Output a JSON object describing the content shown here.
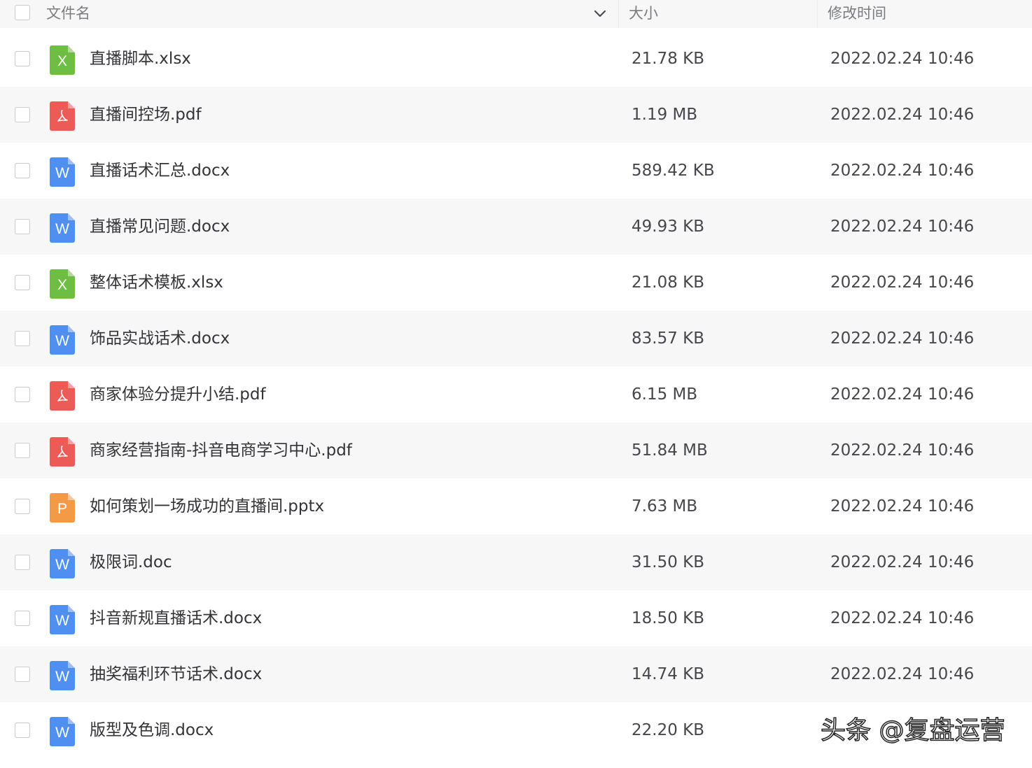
{
  "header": {
    "name_label": "文件名",
    "size_label": "大小",
    "modified_label": "修改时间"
  },
  "file_type_colors": {
    "xlsx": "#6fbe44",
    "pdf": "#ec5b56",
    "docx": "#4e8ff0",
    "doc": "#4e8ff0",
    "pptx": "#f39a47"
  },
  "files": [
    {
      "name": "直播脚本.xlsx",
      "type": "xlsx",
      "icon_letter": "X",
      "size": "21.78 KB",
      "modified": "2022.02.24 10:46"
    },
    {
      "name": "直播间控场.pdf",
      "type": "pdf",
      "icon_letter": "",
      "size": "1.19 MB",
      "modified": "2022.02.24 10:46"
    },
    {
      "name": "直播话术汇总.docx",
      "type": "docx",
      "icon_letter": "W",
      "size": "589.42 KB",
      "modified": "2022.02.24 10:46"
    },
    {
      "name": "直播常见问题.docx",
      "type": "docx",
      "icon_letter": "W",
      "size": "49.93 KB",
      "modified": "2022.02.24 10:46"
    },
    {
      "name": "整体话术模板.xlsx",
      "type": "xlsx",
      "icon_letter": "X",
      "size": "21.08 KB",
      "modified": "2022.02.24 10:46"
    },
    {
      "name": "饰品实战话术.docx",
      "type": "docx",
      "icon_letter": "W",
      "size": "83.57 KB",
      "modified": "2022.02.24 10:46"
    },
    {
      "name": "商家体验分提升小结.pdf",
      "type": "pdf",
      "icon_letter": "",
      "size": "6.15 MB",
      "modified": "2022.02.24 10:46"
    },
    {
      "name": "商家经营指南-抖音电商学习中心.pdf",
      "type": "pdf",
      "icon_letter": "",
      "size": "51.84 MB",
      "modified": "2022.02.24 10:46"
    },
    {
      "name": "如何策划一场成功的直播间.pptx",
      "type": "pptx",
      "icon_letter": "P",
      "size": "7.63 MB",
      "modified": "2022.02.24 10:46"
    },
    {
      "name": "极限词.doc",
      "type": "doc",
      "icon_letter": "W",
      "size": "31.50 KB",
      "modified": "2022.02.24 10:46"
    },
    {
      "name": "抖音新规直播话术.docx",
      "type": "docx",
      "icon_letter": "W",
      "size": "18.50 KB",
      "modified": "2022.02.24 10:46"
    },
    {
      "name": "抽奖福利环节话术.docx",
      "type": "docx",
      "icon_letter": "W",
      "size": "14.74 KB",
      "modified": "2022.02.24 10:46"
    },
    {
      "name": "版型及色调.docx",
      "type": "docx",
      "icon_letter": "W",
      "size": "22.20 KB",
      "modified": "",
      "modified_obscured": true
    }
  ],
  "watermark": "头条 @复盘运营"
}
